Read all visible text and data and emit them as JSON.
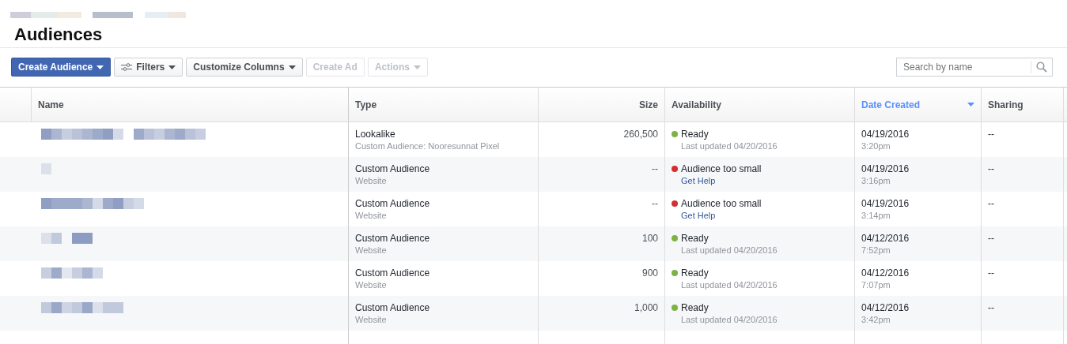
{
  "page_title": "Audiences",
  "toolbar": {
    "buttons": [
      {
        "label": "Create Audience",
        "kind": "primary",
        "dropdown": true,
        "disabled": false
      },
      {
        "label": "Filters",
        "kind": "filter",
        "dropdown": true,
        "disabled": false
      },
      {
        "label": "Customize Columns",
        "kind": "default",
        "dropdown": true,
        "disabled": false
      },
      {
        "label": "Create Ad",
        "kind": "default",
        "dropdown": false,
        "disabled": true
      },
      {
        "label": "Actions",
        "kind": "default",
        "dropdown": true,
        "disabled": true
      }
    ],
    "search": {
      "placeholder": "Search by name"
    }
  },
  "table": {
    "columns": [
      {
        "label": "Name",
        "sorted": false
      },
      {
        "label": "Type",
        "sorted": false
      },
      {
        "label": "Size",
        "sorted": false
      },
      {
        "label": "Availability",
        "sorted": false
      },
      {
        "label": "Date Created",
        "sorted": true
      },
      {
        "label": "Sharing",
        "sorted": false
      }
    ],
    "rows": [
      {
        "type": "Lookalike",
        "source": "Custom Audience: Nooresunnat Pixel",
        "size": "260,500",
        "status": "Ready",
        "color": "#7cb342",
        "note": "Last updated 04/20/2016",
        "date": "04/19/2016",
        "time": "3:20pm",
        "sharing": "--"
      },
      {
        "type": "Custom Audience",
        "source": "Website",
        "size": "--",
        "status": "Audience too small",
        "color": "#d32f2f",
        "help_link": "Get Help",
        "date": "04/19/2016",
        "time": "3:16pm",
        "sharing": "--"
      },
      {
        "type": "Custom Audience",
        "source": "Website",
        "size": "--",
        "status": "Audience too small",
        "color": "#d32f2f",
        "help_link": "Get Help",
        "date": "04/19/2016",
        "time": "3:14pm",
        "sharing": "--"
      },
      {
        "type": "Custom Audience",
        "source": "Website",
        "size": "100",
        "status": "Ready",
        "color": "#7cb342",
        "note": "Last updated 04/20/2016",
        "date": "04/12/2016",
        "time": "7:52pm",
        "sharing": "--"
      },
      {
        "type": "Custom Audience",
        "source": "Website",
        "size": "900",
        "status": "Ready",
        "color": "#7cb342",
        "note": "Last updated 04/20/2016",
        "date": "04/12/2016",
        "time": "7:07pm",
        "sharing": "--"
      },
      {
        "type": "Custom Audience",
        "source": "Website",
        "size": "1,000",
        "status": "Ready",
        "color": "#7cb342",
        "note": "Last updated 04/20/2016",
        "date": "04/12/2016",
        "time": "3:42pm",
        "sharing": "--"
      }
    ]
  }
}
